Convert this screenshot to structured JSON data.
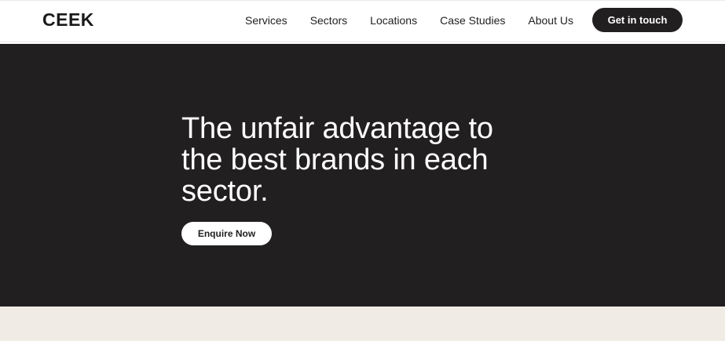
{
  "header": {
    "logo": "CEEK",
    "nav": [
      "Services",
      "Sectors",
      "Locations",
      "Case Studies",
      "About Us"
    ],
    "cta_label": "Get in touch"
  },
  "hero": {
    "headline": "The unfair advantage to the best brands in each sector.",
    "button_label": "Enquire Now"
  },
  "colors": {
    "dark": "#221f21",
    "light_section": "#f0ebe4",
    "header_bg": "#ffffff"
  }
}
